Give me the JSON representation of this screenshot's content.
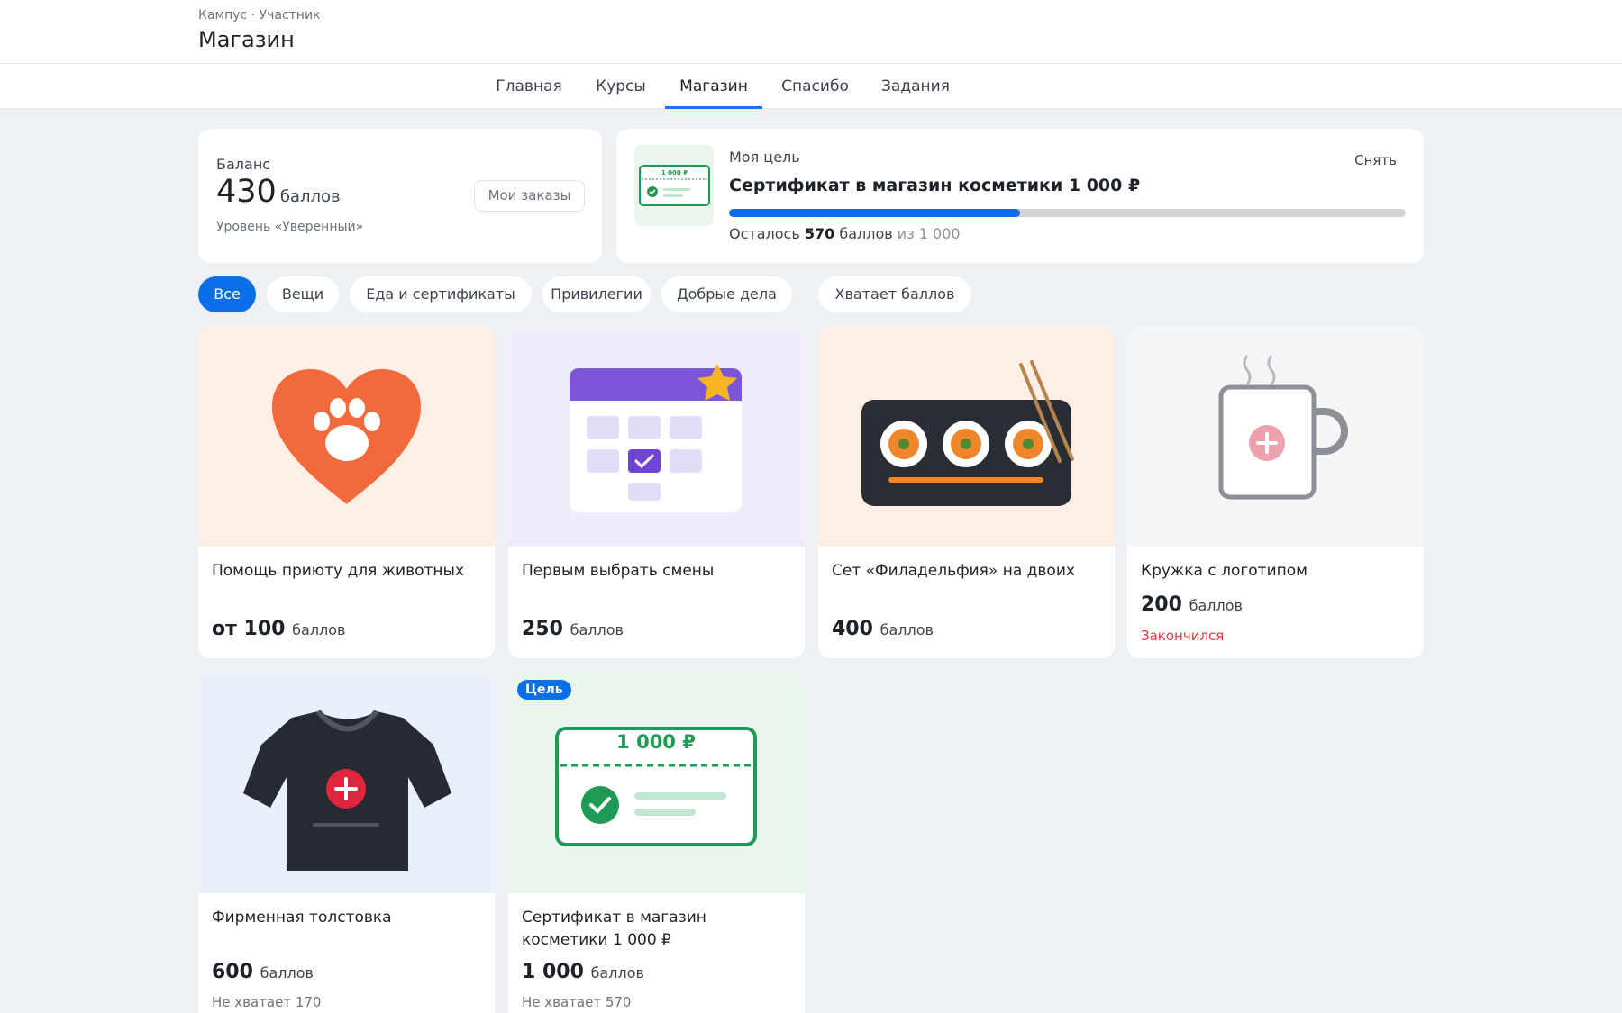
{
  "header": {
    "breadcrumb": "Кампус · Участник",
    "title": "Магазин"
  },
  "tabs": [
    {
      "label": "Главная",
      "active": false
    },
    {
      "label": "Курсы",
      "active": false
    },
    {
      "label": "Магазин",
      "active": true
    },
    {
      "label": "Спасибо",
      "active": false
    },
    {
      "label": "Задания",
      "active": false
    }
  ],
  "balance": {
    "label": "Баланс",
    "value": "430",
    "unit": "баллов",
    "level": "Уровень «Уверенный»",
    "orders_button": "Мои заказы"
  },
  "goal": {
    "label": "Моя цель",
    "title": "Сертификат в магазин косметики 1 000 ₽",
    "remove_label": "Снять",
    "progress": 0.43,
    "remaining_prefix": "Осталось",
    "remaining_value": "570",
    "remaining_unit": "баллов",
    "remaining_of": "из 1 000",
    "thumb_text": "1 000 ₽"
  },
  "filters": [
    {
      "label": "Все",
      "active": true
    },
    {
      "label": "Вещи",
      "active": false
    },
    {
      "label": "Еда и сертификаты",
      "active": false
    },
    {
      "label": "Привилегии",
      "active": false
    },
    {
      "label": "Добрые дела",
      "active": false
    },
    {
      "label": "Хватает баллов",
      "active": false
    }
  ],
  "products": [
    {
      "name": "Помощь приюту для животных",
      "price_prefix": "от ",
      "price": "100",
      "unit": "баллов",
      "note": "",
      "icon": "paw-heart-icon",
      "bg": "#fdefe6"
    },
    {
      "name": "Первым выбрать смены",
      "price_prefix": "",
      "price": "250",
      "unit": "баллов",
      "note": "",
      "icon": "calendar-star-icon",
      "bg": "#f0ecfb"
    },
    {
      "name": "Сет «Филадельфия» на двоих",
      "price_prefix": "",
      "price": "400",
      "unit": "баллов",
      "note": "",
      "icon": "sushi-set-icon",
      "bg": "#fdefe6"
    },
    {
      "name": "Кружка с логотипом",
      "price_prefix": "",
      "price": "200",
      "unit": "баллов",
      "note": "Закончился",
      "icon": "mug-icon",
      "bg": "#f4f5f7"
    },
    {
      "name": "Фирменная толстовка",
      "price_prefix": "",
      "price": "600",
      "unit": "баллов",
      "note": "Не хватает 170",
      "icon": "sweatshirt-icon",
      "bg": "#e9f0fb"
    },
    {
      "name": "Сертификат в магазин косметики 1 000 ₽",
      "price_prefix": "",
      "price": "1 000",
      "unit": "баллов",
      "note": "Не хватает 570",
      "icon": "certificate-icon",
      "bg": "#eaf5ed",
      "badge": "Цель",
      "cert_amount": "1 000 ₽"
    }
  ],
  "colors": {
    "accent": "#0a6fe8",
    "out_of_stock": "#e03b3b",
    "certificate_green": "#1f9a55"
  }
}
